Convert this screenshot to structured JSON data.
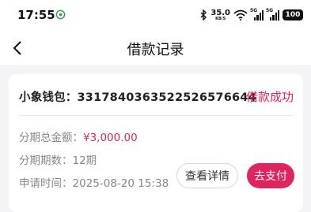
{
  "status_bar": {
    "time": "17:55",
    "network_speed": "35.0",
    "network_speed_unit": "KB/S",
    "sim1_label": "5G",
    "sim2_label": "5G",
    "battery": "100"
  },
  "nav": {
    "title": "借款记录"
  },
  "record": {
    "wallet": "小象钱包：3317840363522526576644",
    "status": "借款成功",
    "total_label": "分期总金额：",
    "total_value": "¥3,000.00",
    "periods_label": "分期期数：",
    "periods_value": "12期",
    "apply_time_label": "申请时间：",
    "apply_time_value": "2025-08-20 15:38",
    "detail_button": "查看详情",
    "pay_button": "去支付"
  },
  "colors": {
    "accent": "#e0245e",
    "background": "#f4f4f6"
  }
}
